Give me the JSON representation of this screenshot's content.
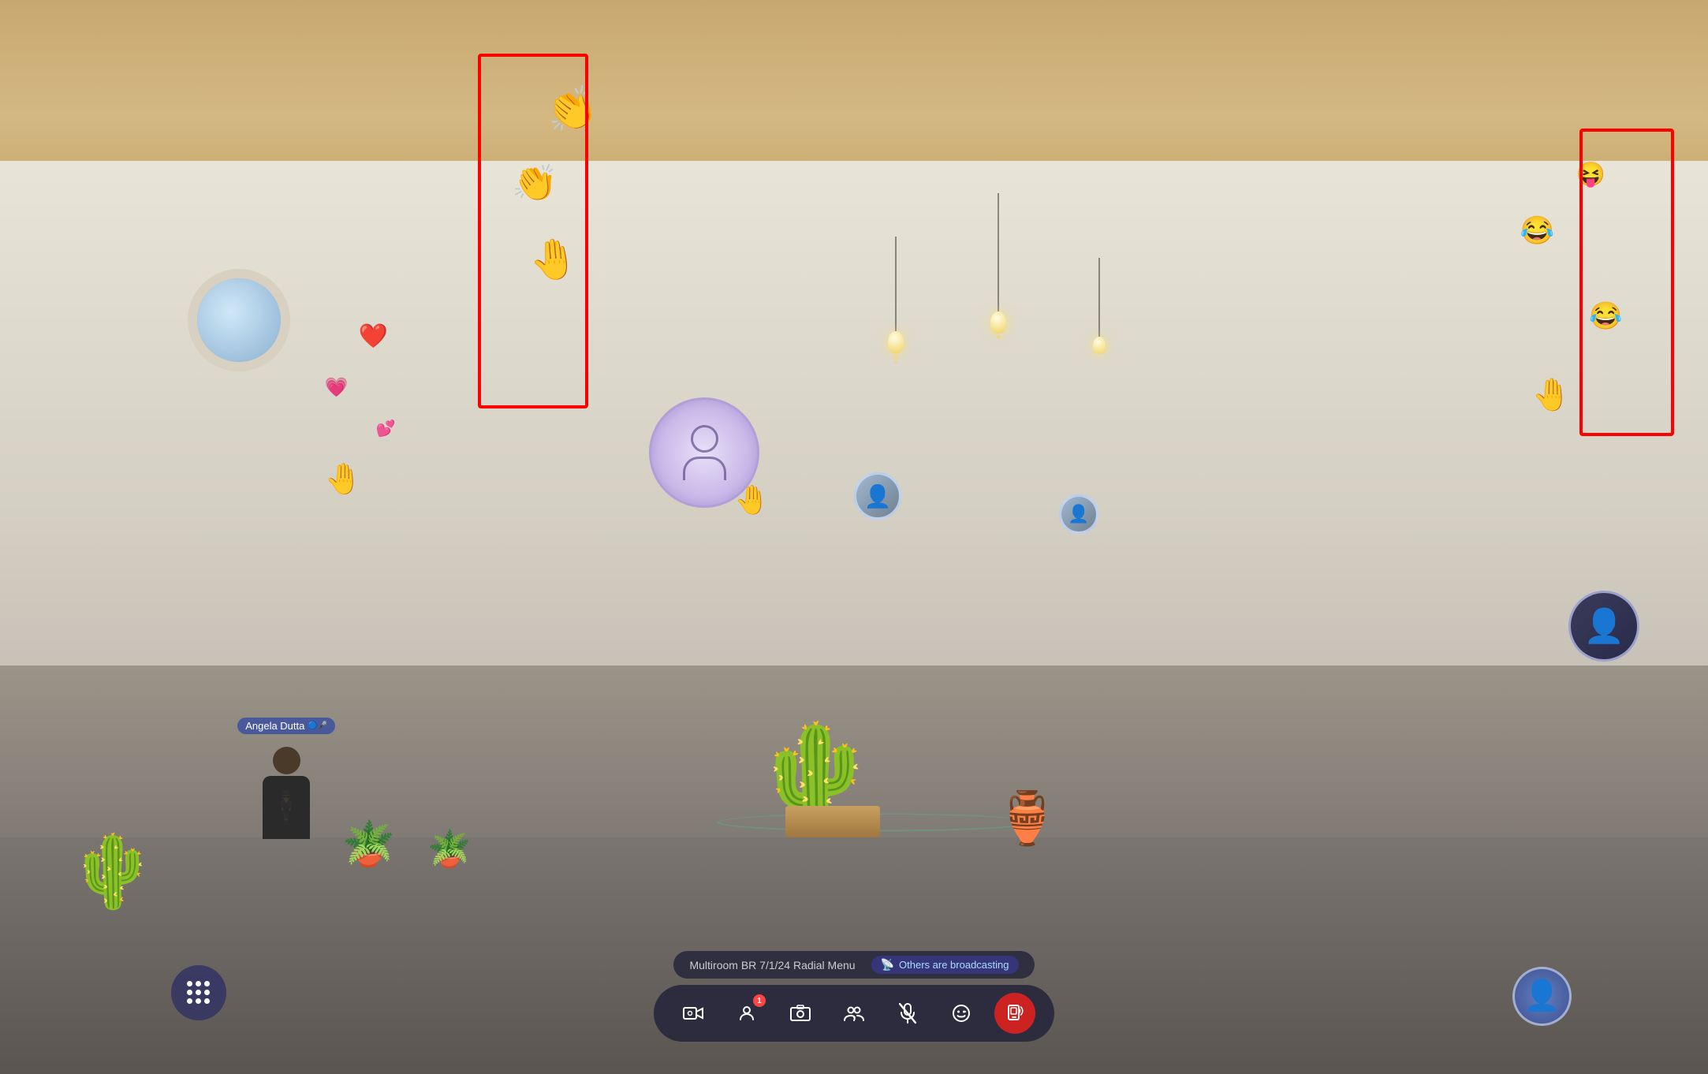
{
  "scene": {
    "background": "metaverse desert courtyard",
    "emojis_left": [
      "🤚",
      "👏",
      "👏",
      "👏"
    ],
    "emojis_right": [
      "😂",
      "😝",
      "😂",
      "🤚"
    ],
    "hearts": [
      "❤️",
      "💗",
      "💕"
    ]
  },
  "avatars": {
    "angela": {
      "name": "Angela Dutta",
      "badge_text": "Angela Dutta",
      "icon": "👤"
    },
    "center_placeholder": {
      "icon": "👤"
    },
    "small_person": {
      "icon": "👤"
    },
    "right_broadcaster": {
      "icon": "👤"
    },
    "user_self": {
      "icon": "👤"
    }
  },
  "highlights": {
    "left_box": "broadcasting area left",
    "right_box": "broadcasting area right"
  },
  "toolbar": {
    "menu_dots_label": "⠿",
    "buttons": [
      {
        "id": "camera",
        "icon": "🎬",
        "label": "Camera"
      },
      {
        "id": "person",
        "icon": "👤",
        "label": "Person",
        "badge": "1"
      },
      {
        "id": "photo",
        "icon": "📷",
        "label": "Photo"
      },
      {
        "id": "group",
        "icon": "👥",
        "label": "Group"
      },
      {
        "id": "mic-mute",
        "icon": "🎤",
        "label": "Mute mic"
      },
      {
        "id": "emoji",
        "icon": "😊",
        "label": "Emoji"
      },
      {
        "id": "broadcast",
        "icon": "📱",
        "label": "Broadcast",
        "active": true
      }
    ]
  },
  "status_bar": {
    "room_name": "Multiroom BR 7/1/24 Radial Menu",
    "broadcast_status": "Others are broadcasting",
    "broadcast_icon": "📡"
  }
}
